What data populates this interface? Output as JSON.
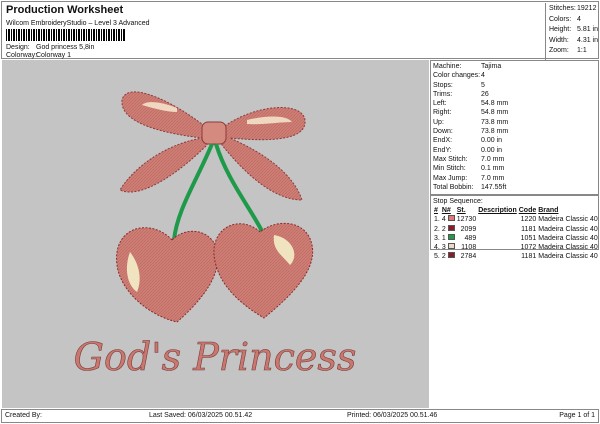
{
  "header": {
    "title": "Production Worksheet",
    "subtitle": "Wilcom EmbroideryStudio – Level 3 Advanced",
    "design_label": "Design:",
    "design": "God princess 5,8in",
    "colorway_label": "Colorway:",
    "colorway": "Colorway 1"
  },
  "stats": [
    {
      "k": "Stitches:",
      "v": "19212"
    },
    {
      "k": "Colors:",
      "v": "4"
    },
    {
      "k": "Height:",
      "v": "5.81 in"
    },
    {
      "k": "Width:",
      "v": "4.31 in"
    },
    {
      "k": "Zoom:",
      "v": "1:1"
    }
  ],
  "info": [
    {
      "k": "Machine:",
      "v": "Tajima"
    },
    {
      "k": "Color changes:",
      "v": "4"
    },
    {
      "k": "Stops:",
      "v": "5"
    },
    {
      "k": "Trims:",
      "v": "26"
    },
    {
      "k": "Left:",
      "v": "54.8 mm"
    },
    {
      "k": "Right:",
      "v": "54.8 mm"
    },
    {
      "k": "Up:",
      "v": "73.8 mm"
    },
    {
      "k": "Down:",
      "v": "73.8 mm"
    },
    {
      "k": "EndX:",
      "v": "0.00 in"
    },
    {
      "k": "EndY:",
      "v": "0.00 in"
    },
    {
      "k": "Max Stitch:",
      "v": "7.0 mm"
    },
    {
      "k": "Min Stitch:",
      "v": "0.1 mm"
    },
    {
      "k": "Max Jump:",
      "v": "7.0 mm"
    },
    {
      "k": "Total Bobbin:",
      "v": "147.55ft"
    }
  ],
  "stops": {
    "title": "Stop Sequence:",
    "headers": [
      "#",
      "N#",
      "St.",
      "Description",
      "Code",
      "Brand"
    ],
    "rows": [
      {
        "n": "1.",
        "c": "4",
        "color": "#e07a7a",
        "st": "12730",
        "desc": "",
        "code": "1220",
        "brand": "Madeira Classic 40"
      },
      {
        "n": "2.",
        "c": "2",
        "color": "#8b1a2a",
        "st": "2099",
        "desc": "",
        "code": "1181",
        "brand": "Madeira Classic 40"
      },
      {
        "n": "3.",
        "c": "1",
        "color": "#1e9a4a",
        "st": "489",
        "desc": "",
        "code": "1051",
        "brand": "Madeira Classic 40"
      },
      {
        "n": "4.",
        "c": "3",
        "color": "#e8dcc8",
        "st": "1108",
        "desc": "",
        "code": "1072",
        "brand": "Madeira Classic 40"
      },
      {
        "n": "5.",
        "c": "2",
        "color": "#8b1a2a",
        "st": "2784",
        "desc": "",
        "code": "1181",
        "brand": "Madeira Classic 40"
      }
    ]
  },
  "design_text": "God's Princess",
  "footer": {
    "created": "Created By:",
    "saved": "Last Saved: 06/03/2025 00.51.42",
    "printed": "Printed: 06/03/2025 00.51.46",
    "page": "Page 1 of 1"
  }
}
